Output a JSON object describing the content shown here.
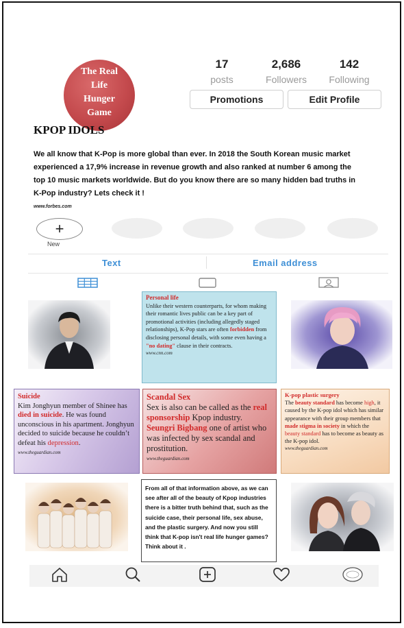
{
  "profile": {
    "avatar_text": "The Real Life Hunger Game",
    "avatar_lines": [
      "The Real",
      "Life",
      "Hunger",
      "Game"
    ],
    "name": "KPOP IDOLS",
    "bio": "We all know that K-Pop is more global than ever. In 2018 the South Korean music market experienced a 17,9% increase in revenue growth and also ranked at number 6 among the top 10 music markets worldwide. But do you know there are so many hidden bad truths in K-Pop industry? Lets check it !",
    "bio_source": "www.forbes.com"
  },
  "stats": [
    {
      "value": "17",
      "label": "posts"
    },
    {
      "value": "2,686",
      "label": "Followers"
    },
    {
      "value": "142",
      "label": "Following"
    }
  ],
  "buttons": {
    "promotions": "Promotions",
    "edit_profile": "Edit Profile"
  },
  "highlights": {
    "new_label": "New",
    "new_symbol": "+"
  },
  "contact": {
    "text": "Text",
    "email": "Email address"
  },
  "tiles": {
    "personal_life": {
      "title": "Personal life",
      "parts": [
        "Unlike their western counterparts, for whom making their romantic lives public can be a key part of promotional activities (including allegedly staged relationships), K-Pop stars are often ",
        "forbidden",
        " from disclosing personal details, with some even having a ",
        "\"no dating\"",
        " clause in their contracts."
      ],
      "source": "www.cnn.com"
    },
    "suicide": {
      "title": "Suicide",
      "parts": [
        "Kim Jonghyun member of Shinee has ",
        "died in suicide",
        ". He was found unconscious in his apartment. Jonghyun decided to suicide because he couldn’t defeat his ",
        "depression",
        "."
      ],
      "source": "www.theguardian.com"
    },
    "scandal": {
      "title": "Scandal Sex",
      "parts": [
        "Sex is also can be called as the ",
        "real sponsorship",
        " Kpop industry. ",
        "Seungri Bigbang",
        " one of artist who was infected by sex scandal and prostitution."
      ],
      "source": "www.theguardian.com"
    },
    "plastic": {
      "title": "K-pop plastic surgery",
      "parts": [
        "The ",
        "beauty standard",
        " has become ",
        "high",
        ", it caused by the K-pop idol which has similar appearance with their group members that ",
        "made stigma in society",
        " in which the ",
        "beauty standard",
        " has to become as beauty as the K-pop idol."
      ],
      "source": "www.theguardian.com"
    },
    "conclusion": {
      "text": "From all of that information above, as we can see after all of the beauty of Kpop industries there is a bitter truth behind that, such as the suicide case, their personal life, sex abuse, and the plastic surgery.  And now you still think that K-pop isn't real life hunger games? Think about it ."
    }
  },
  "icons": {
    "grid": "grid-icon",
    "tv": "tv-icon",
    "tagged": "tagged-icon",
    "home": "home-icon",
    "search": "search-icon",
    "add": "add-post-icon",
    "heart": "heart-icon",
    "profile": "profile-icon"
  },
  "colors": {
    "accent_blue": "#3e8fd6",
    "highlight_red": "#d12a2a",
    "avatar_red": "#c44a4d"
  }
}
